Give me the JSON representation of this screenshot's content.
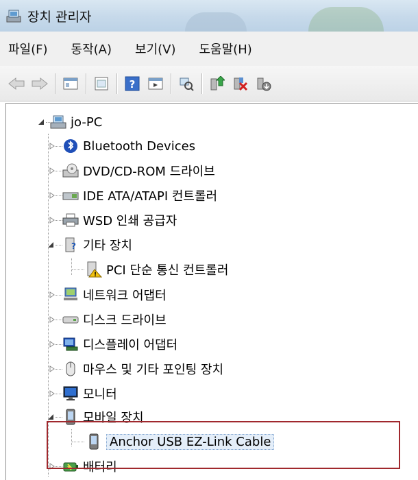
{
  "window": {
    "title": "장치 관리자"
  },
  "menu": [
    "파일(F)",
    "동작(A)",
    "보기(V)",
    "도움말(H)"
  ],
  "toolbar": {
    "buttons": [
      "back-icon",
      "forward-icon",
      "properties-view-icon",
      "show-hide-tree-icon",
      "help-icon",
      "action-pane-icon",
      "scan-hardware-icon",
      "update-driver-icon",
      "uninstall-icon",
      "disable-icon"
    ]
  },
  "tree": {
    "root": "jo-PC",
    "items": [
      {
        "label": "Bluetooth Devices",
        "icon": "bluetooth-icon"
      },
      {
        "label": "DVD/CD-ROM 드라이브",
        "icon": "dvd-drive-icon"
      },
      {
        "label": "IDE ATA/ATAPI 컨트롤러",
        "icon": "ide-controller-icon"
      },
      {
        "label": "WSD 인쇄 공급자",
        "icon": "printer-icon"
      },
      {
        "label": "기타 장치",
        "icon": "other-devices-icon"
      },
      {
        "label": "PCI 단순 통신 컨트롤러",
        "icon": "warning-device-icon"
      },
      {
        "label": "네트워크 어댑터",
        "icon": "network-adapter-icon"
      },
      {
        "label": "디스크 드라이브",
        "icon": "disk-drive-icon"
      },
      {
        "label": "디스플레이 어댑터",
        "icon": "display-adapter-icon"
      },
      {
        "label": "마우스 및 기타 포인팅 장치",
        "icon": "mouse-icon"
      },
      {
        "label": "모니터",
        "icon": "monitor-icon"
      },
      {
        "label": "모바일 장치",
        "icon": "mobile-device-icon"
      },
      {
        "label": "Anchor USB EZ-Link Cable",
        "icon": "mobile-device-icon"
      },
      {
        "label": "배터리",
        "icon": "battery-icon"
      }
    ]
  }
}
